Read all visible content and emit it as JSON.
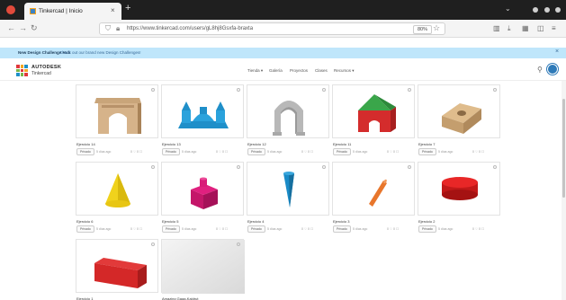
{
  "browser": {
    "tab_title": "Tinkercad | Inicio",
    "tab_close": "×",
    "new_tab": "+",
    "url": "https://www.tinkercad.com/users/gL8hj8Gsxfa-braxta",
    "zoom": "80%"
  },
  "banner": {
    "bold": "New Design Challenge Hub",
    "link": "Check out our brand new Design Challenges!"
  },
  "header": {
    "brand_top": "AUTODESK",
    "brand_bottom": "Tinkercad",
    "menu": [
      "Tienda ▾",
      "Galería",
      "Proyectos",
      "Clases",
      "Recursos ▾"
    ],
    "logo_colors": [
      "#e1383b",
      "#f5a623",
      "#1e90c8",
      "#7ab648",
      "#e1383b",
      "#f5a623",
      "#1e90c8",
      "#7ab648",
      "#e1383b"
    ]
  },
  "cards": [
    {
      "name": "Ejercicio 14",
      "privacy": "Privado",
      "time": "5 días ago",
      "stats": "0 ♡  0 ☐",
      "shape": "arch"
    },
    {
      "name": "Ejercicio 13",
      "privacy": "Privado",
      "time": "5 días ago",
      "stats": "0 ♡  0 ☐",
      "shape": "castle"
    },
    {
      "name": "Ejercicio 12",
      "privacy": "Privado",
      "time": "5 días ago",
      "stats": "0 ♡  0 ☐",
      "shape": "gray-arch"
    },
    {
      "name": "Ejercicio 11",
      "privacy": "Privado",
      "time": "5 días ago",
      "stats": "0 ♡  0 ☐",
      "shape": "house"
    },
    {
      "name": "Ejercicio 7",
      "privacy": "Privado",
      "time": "5 días ago",
      "stats": "0 ♡  0 ☐",
      "shape": "box-hole"
    },
    {
      "name": "Ejercicio 6",
      "privacy": "Privado",
      "time": "5 días ago",
      "stats": "0 ♡  0 ☐",
      "shape": "cone"
    },
    {
      "name": "Ejercicio 5",
      "privacy": "Privado",
      "time": "5 días ago",
      "stats": "0 ♡  0 ☐",
      "shape": "magenta-block"
    },
    {
      "name": "Ejercicio 4",
      "privacy": "Privado",
      "time": "5 días ago",
      "stats": "0 ♡  0 ☐",
      "shape": "blue-cone"
    },
    {
      "name": "Ejercicio 3",
      "privacy": "Privado",
      "time": "5 días ago",
      "stats": "0 ♡  0 ☐",
      "shape": "cylinder-stick"
    },
    {
      "name": "Ejercicio 2",
      "privacy": "Privado",
      "time": "5 días ago",
      "stats": "0 ♡  0 ☐",
      "shape": "red-cylinder"
    },
    {
      "name": "Ejercicio 1",
      "privacy": "Privado",
      "time": "5 días ago",
      "stats": "",
      "shape": "red-box"
    },
    {
      "name": "Amazing Gaaa-Kaldrut",
      "privacy": "",
      "time": "",
      "stats": "",
      "shape": "blank"
    }
  ]
}
